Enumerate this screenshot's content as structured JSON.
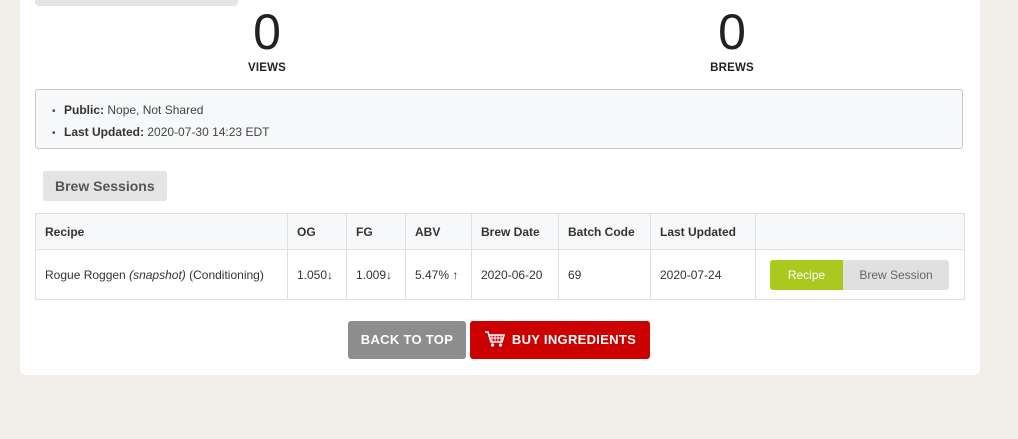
{
  "stats": [
    {
      "number": "0",
      "label": "VIEWS"
    },
    {
      "number": "0",
      "label": "BREWS"
    }
  ],
  "meta": {
    "public_label": "Public:",
    "public_value": "Nope, Not Shared",
    "updated_label": "Last Updated:",
    "updated_value": "2020-07-30 14:23 EDT"
  },
  "section_title": "Brew Sessions",
  "table": {
    "headers": [
      "Recipe",
      "OG",
      "FG",
      "ABV",
      "Brew Date",
      "Batch Code",
      "Last Updated",
      ""
    ],
    "rows": [
      {
        "recipe_name": "Rogue Roggen",
        "recipe_snapshot": "(snapshot)",
        "recipe_status": "(Conditioning)",
        "og": "1.050",
        "og_arrow": "↓",
        "fg": "1.009",
        "fg_arrow": "↓",
        "abv": "5.47%",
        "abv_arrow": "↑",
        "brew_date": "2020-06-20",
        "batch_code": "69",
        "last_updated": "2020-07-24",
        "recipe_button": "Recipe",
        "session_button": "Brew Session"
      }
    ]
  },
  "buttons": {
    "back_to_top": "BACK TO TOP",
    "buy_ingredients": "BUY INGREDIENTS"
  },
  "colors": {
    "background": "#f2efea",
    "recipe_green": "#a9c91e",
    "buy_red": "#cc0000",
    "back_gray": "#8d8d8d"
  }
}
